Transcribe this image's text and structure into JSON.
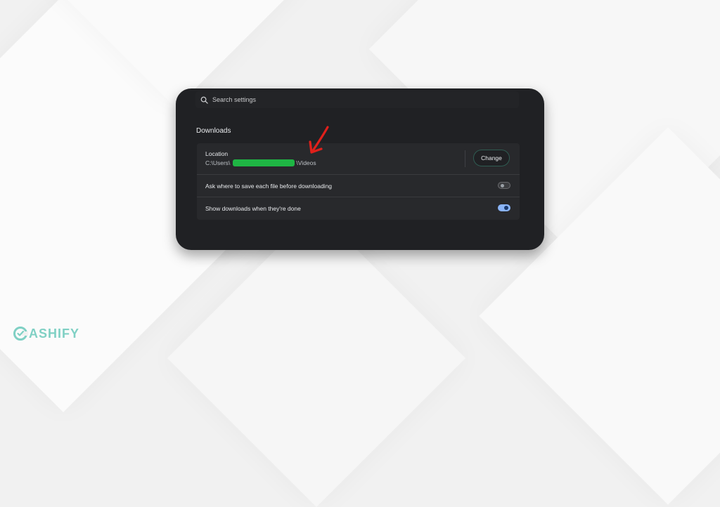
{
  "search": {
    "placeholder": "Search settings",
    "icon": "search-icon"
  },
  "downloads": {
    "section_title": "Downloads",
    "location": {
      "label": "Location",
      "path_prefix": "C:\\Users\\",
      "path_suffix": "\\Videos",
      "change_label": "Change"
    },
    "ask_where": {
      "label": "Ask where to save each file before downloading",
      "enabled": false
    },
    "show_when_done": {
      "label": "Show downloads when they're done",
      "enabled": true
    }
  },
  "brand": {
    "name": "ASHIFY",
    "logo_icon": "cashify-c-logo-icon"
  },
  "colors": {
    "card_bg": "#202124",
    "panel_bg": "#28292c",
    "redaction": "#1fb644",
    "toggle_on": "#8ab4f8",
    "annotation_arrow": "#e0201b",
    "brand": "#7fd0c4"
  }
}
